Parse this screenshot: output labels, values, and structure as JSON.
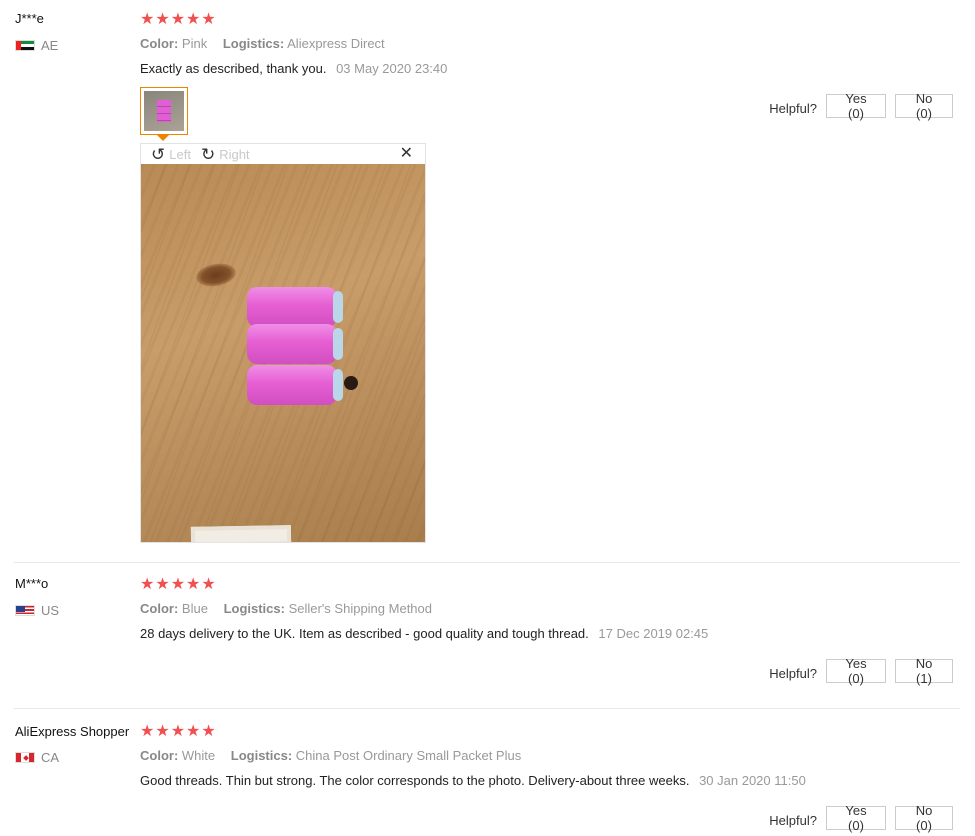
{
  "helpful_label": "Helpful?",
  "meta_labels": {
    "color": "Color:",
    "logistics": "Logistics:"
  },
  "star_rating": "★★★★★",
  "viewer": {
    "rotate_left": "Left",
    "rotate_right": "Right"
  },
  "colors": {
    "star": "#f0504f",
    "thumb_border": "#f08200"
  },
  "reviews": [
    {
      "user": "J***e",
      "country": "AE",
      "rating": 5,
      "color": "Pink",
      "logistics": "Aliexpress Direct",
      "text": "Exactly as described, thank you.",
      "date": "03 May 2020 23:40",
      "yes": "Yes (0)",
      "no": "No (0)"
    },
    {
      "user": "M***o",
      "country": "US",
      "rating": 5,
      "color": "Blue",
      "logistics": "Seller's Shipping Method",
      "text": "28 days delivery to the UK. Item as described - good quality and tough thread.",
      "date": "17 Dec 2019 02:45",
      "yes": "Yes (0)",
      "no": "No (1)"
    },
    {
      "user": "AliExpress Shopper",
      "country": "CA",
      "rating": 5,
      "color": "White",
      "logistics": "China Post Ordinary Small Packet Plus",
      "text": "Good threads. Thin but strong. The color corresponds to the photo. Delivery-about three weeks.",
      "date": "30 Jan 2020 11:50",
      "yes": "Yes (0)",
      "no": "No (0)"
    }
  ]
}
